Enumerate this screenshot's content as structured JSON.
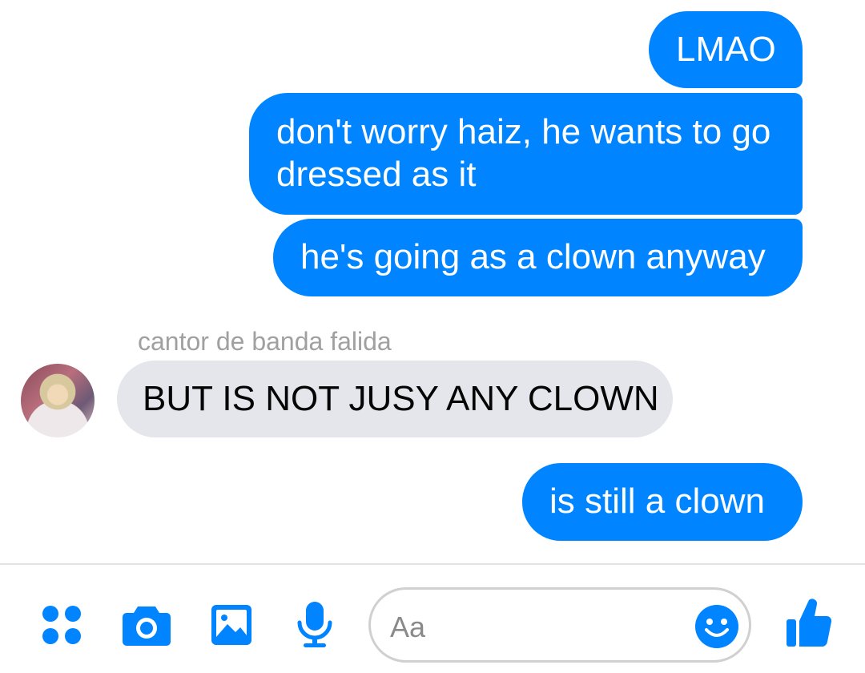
{
  "thread": {
    "messages": [
      {
        "direction": "outgoing",
        "text": "LMAO"
      },
      {
        "direction": "outgoing",
        "text": "don't worry haiz, he wants to go dressed as it"
      },
      {
        "direction": "outgoing",
        "text": "he's going as a clown anyway"
      },
      {
        "direction": "incoming",
        "sender": "cantor de banda falida",
        "text": "BUT IS NOT JUSY ANY CLOWN"
      },
      {
        "direction": "outgoing",
        "text": "is still a clown"
      }
    ]
  },
  "composer": {
    "placeholder": "Aa",
    "icons": [
      "more-apps-icon",
      "camera-icon",
      "gallery-icon",
      "microphone-icon",
      "emoji-icon",
      "thumbs-up-icon"
    ]
  },
  "colors": {
    "accent": "#0084ff",
    "incoming_bubble": "#e4e6eb",
    "sender_text": "#a0a0a0"
  }
}
